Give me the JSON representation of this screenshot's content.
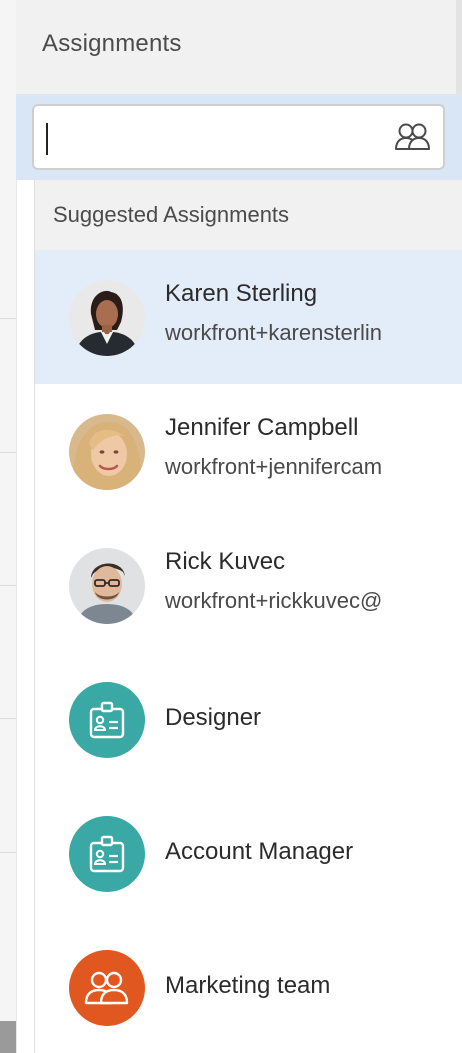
{
  "header": {
    "title": "Assignments"
  },
  "search": {
    "value": "",
    "icon": "people-icon"
  },
  "suggestions": {
    "title": "Suggested Assignments",
    "items": [
      {
        "name": "Karen Sterling",
        "email": "workfront+karensterlin",
        "kind": "user",
        "selected": true
      },
      {
        "name": "Jennifer Campbell",
        "email": "workfront+jennifercam",
        "kind": "user",
        "selected": false
      },
      {
        "name": "Rick Kuvec",
        "email": "workfront+rickkuvec@",
        "kind": "user",
        "selected": false
      },
      {
        "name": "Designer",
        "kind": "job-role",
        "selected": false
      },
      {
        "name": "Account Manager",
        "kind": "job-role",
        "selected": false
      },
      {
        "name": "Marketing team",
        "kind": "team",
        "selected": false
      }
    ]
  },
  "colors": {
    "role_teal": "#3aa9a6",
    "team_orange": "#e0571f",
    "selected_row": "#e3edf9",
    "search_band": "#d8e6f5"
  }
}
